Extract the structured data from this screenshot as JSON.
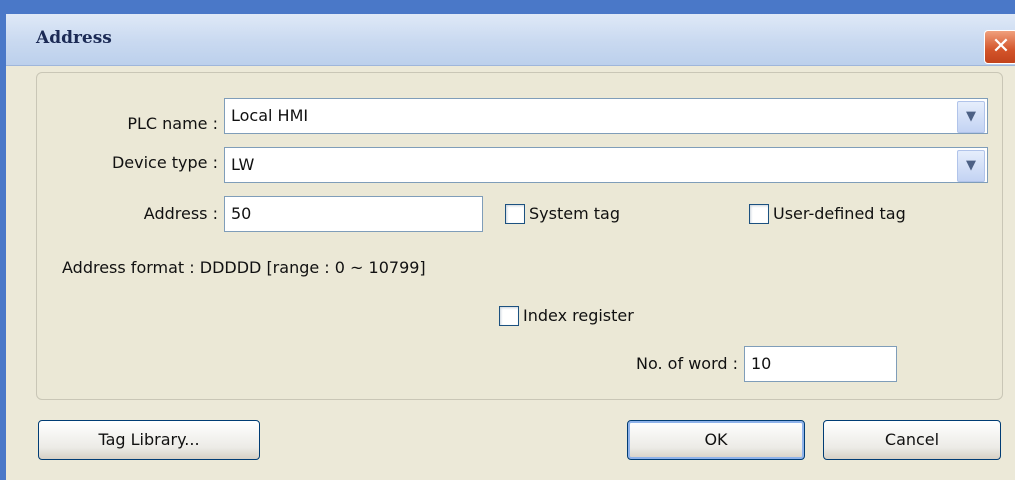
{
  "window": {
    "title": "Address",
    "close_glyph": "✕"
  },
  "form": {
    "plc_name": {
      "label": "PLC name :",
      "value": "Local HMI"
    },
    "device_type": {
      "label": "Device type :",
      "value": "LW"
    },
    "address": {
      "label": "Address :",
      "value": "50"
    },
    "system_tag": {
      "label": "System tag",
      "checked": false
    },
    "user_defined_tag": {
      "label": "User-defined tag",
      "checked": false
    },
    "address_format": "Address format : DDDDD [range : 0 ~ 10799]",
    "index_register": {
      "label": "Index register",
      "checked": false
    },
    "no_of_word": {
      "label": "No. of word :",
      "value": "10"
    }
  },
  "buttons": {
    "tag_library": "Tag Library...",
    "ok": "OK",
    "cancel": "Cancel"
  },
  "icons": {
    "dropdown": "chevron-down-icon",
    "close": "close-icon"
  },
  "colors": {
    "titlebar": "#c9d9f0",
    "close_button": "#d3542a",
    "dialog_face": "#ece9d8",
    "input_border": "#7f9db9"
  }
}
